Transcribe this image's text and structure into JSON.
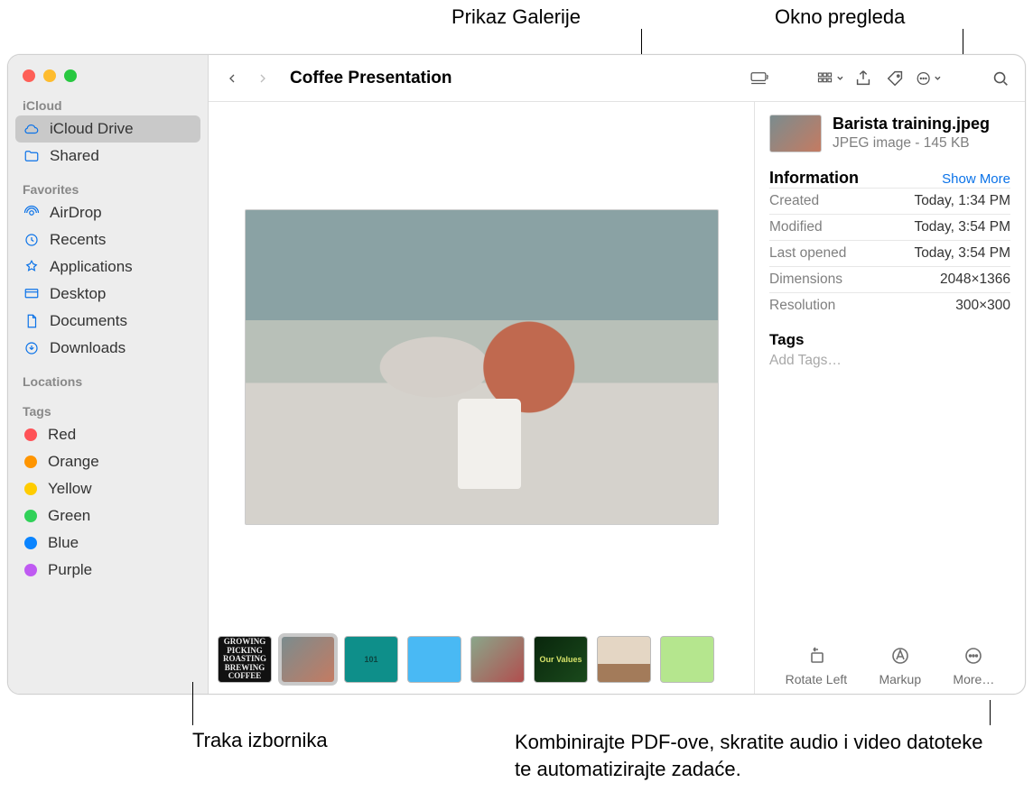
{
  "callouts": {
    "galleryView": "Prikaz Galerije",
    "previewPane": "Okno pregleda",
    "thumbStrip": "Traka izbornika",
    "quickActions": "Kombinirajte PDF-ove, skratite audio i video datoteke te automatizirajte zadaće."
  },
  "toolbar": {
    "title": "Coffee Presentation"
  },
  "sidebar": {
    "sections": {
      "icloud": "iCloud",
      "favorites": "Favorites",
      "locations": "Locations",
      "tags": "Tags"
    },
    "icloud": [
      {
        "label": "iCloud Drive"
      },
      {
        "label": "Shared"
      }
    ],
    "favorites": [
      {
        "label": "AirDrop"
      },
      {
        "label": "Recents"
      },
      {
        "label": "Applications"
      },
      {
        "label": "Desktop"
      },
      {
        "label": "Documents"
      },
      {
        "label": "Downloads"
      }
    ],
    "tagList": [
      {
        "label": "Red",
        "color": "#ff5257"
      },
      {
        "label": "Orange",
        "color": "#ff9500"
      },
      {
        "label": "Yellow",
        "color": "#ffcc00"
      },
      {
        "label": "Green",
        "color": "#30d158"
      },
      {
        "label": "Blue",
        "color": "#0a84ff"
      },
      {
        "label": "Purple",
        "color": "#bf5af2"
      }
    ]
  },
  "thumbs": [
    {
      "label": "GROWING PICKING ROASTING BREWING COFFEE"
    },
    {
      "label": ""
    },
    {
      "label": "101"
    },
    {
      "label": ""
    },
    {
      "label": ""
    },
    {
      "label": "Our Values"
    },
    {
      "label": ""
    },
    {
      "label": ""
    }
  ],
  "preview": {
    "fileName": "Barista training.jpeg",
    "fileSub": "JPEG image - 145 KB",
    "infoHeader": "Information",
    "showMore": "Show More",
    "rows": [
      {
        "k": "Created",
        "v": "Today, 1:34 PM"
      },
      {
        "k": "Modified",
        "v": "Today, 3:54 PM"
      },
      {
        "k": "Last opened",
        "v": "Today, 3:54 PM"
      },
      {
        "k": "Dimensions",
        "v": "2048×1366"
      },
      {
        "k": "Resolution",
        "v": "300×300"
      }
    ],
    "tagsHeader": "Tags",
    "addTags": "Add Tags…",
    "quickActions": {
      "rotate": "Rotate Left",
      "markup": "Markup",
      "more": "More…"
    }
  }
}
